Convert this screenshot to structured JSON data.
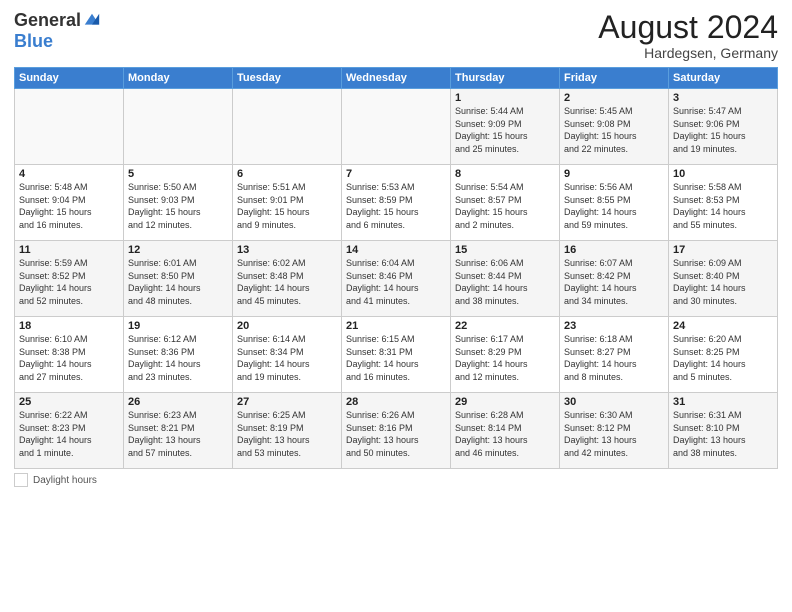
{
  "logo": {
    "general": "General",
    "blue": "Blue"
  },
  "title": {
    "month_year": "August 2024",
    "location": "Hardegsen, Germany"
  },
  "days_of_week": [
    "Sunday",
    "Monday",
    "Tuesday",
    "Wednesday",
    "Thursday",
    "Friday",
    "Saturday"
  ],
  "legend": {
    "label": "Daylight hours"
  },
  "weeks": [
    [
      {
        "day": "",
        "info": ""
      },
      {
        "day": "",
        "info": ""
      },
      {
        "day": "",
        "info": ""
      },
      {
        "day": "",
        "info": ""
      },
      {
        "day": "1",
        "info": "Sunrise: 5:44 AM\nSunset: 9:09 PM\nDaylight: 15 hours\nand 25 minutes."
      },
      {
        "day": "2",
        "info": "Sunrise: 5:45 AM\nSunset: 9:08 PM\nDaylight: 15 hours\nand 22 minutes."
      },
      {
        "day": "3",
        "info": "Sunrise: 5:47 AM\nSunset: 9:06 PM\nDaylight: 15 hours\nand 19 minutes."
      }
    ],
    [
      {
        "day": "4",
        "info": "Sunrise: 5:48 AM\nSunset: 9:04 PM\nDaylight: 15 hours\nand 16 minutes."
      },
      {
        "day": "5",
        "info": "Sunrise: 5:50 AM\nSunset: 9:03 PM\nDaylight: 15 hours\nand 12 minutes."
      },
      {
        "day": "6",
        "info": "Sunrise: 5:51 AM\nSunset: 9:01 PM\nDaylight: 15 hours\nand 9 minutes."
      },
      {
        "day": "7",
        "info": "Sunrise: 5:53 AM\nSunset: 8:59 PM\nDaylight: 15 hours\nand 6 minutes."
      },
      {
        "day": "8",
        "info": "Sunrise: 5:54 AM\nSunset: 8:57 PM\nDaylight: 15 hours\nand 2 minutes."
      },
      {
        "day": "9",
        "info": "Sunrise: 5:56 AM\nSunset: 8:55 PM\nDaylight: 14 hours\nand 59 minutes."
      },
      {
        "day": "10",
        "info": "Sunrise: 5:58 AM\nSunset: 8:53 PM\nDaylight: 14 hours\nand 55 minutes."
      }
    ],
    [
      {
        "day": "11",
        "info": "Sunrise: 5:59 AM\nSunset: 8:52 PM\nDaylight: 14 hours\nand 52 minutes."
      },
      {
        "day": "12",
        "info": "Sunrise: 6:01 AM\nSunset: 8:50 PM\nDaylight: 14 hours\nand 48 minutes."
      },
      {
        "day": "13",
        "info": "Sunrise: 6:02 AM\nSunset: 8:48 PM\nDaylight: 14 hours\nand 45 minutes."
      },
      {
        "day": "14",
        "info": "Sunrise: 6:04 AM\nSunset: 8:46 PM\nDaylight: 14 hours\nand 41 minutes."
      },
      {
        "day": "15",
        "info": "Sunrise: 6:06 AM\nSunset: 8:44 PM\nDaylight: 14 hours\nand 38 minutes."
      },
      {
        "day": "16",
        "info": "Sunrise: 6:07 AM\nSunset: 8:42 PM\nDaylight: 14 hours\nand 34 minutes."
      },
      {
        "day": "17",
        "info": "Sunrise: 6:09 AM\nSunset: 8:40 PM\nDaylight: 14 hours\nand 30 minutes."
      }
    ],
    [
      {
        "day": "18",
        "info": "Sunrise: 6:10 AM\nSunset: 8:38 PM\nDaylight: 14 hours\nand 27 minutes."
      },
      {
        "day": "19",
        "info": "Sunrise: 6:12 AM\nSunset: 8:36 PM\nDaylight: 14 hours\nand 23 minutes."
      },
      {
        "day": "20",
        "info": "Sunrise: 6:14 AM\nSunset: 8:34 PM\nDaylight: 14 hours\nand 19 minutes."
      },
      {
        "day": "21",
        "info": "Sunrise: 6:15 AM\nSunset: 8:31 PM\nDaylight: 14 hours\nand 16 minutes."
      },
      {
        "day": "22",
        "info": "Sunrise: 6:17 AM\nSunset: 8:29 PM\nDaylight: 14 hours\nand 12 minutes."
      },
      {
        "day": "23",
        "info": "Sunrise: 6:18 AM\nSunset: 8:27 PM\nDaylight: 14 hours\nand 8 minutes."
      },
      {
        "day": "24",
        "info": "Sunrise: 6:20 AM\nSunset: 8:25 PM\nDaylight: 14 hours\nand 5 minutes."
      }
    ],
    [
      {
        "day": "25",
        "info": "Sunrise: 6:22 AM\nSunset: 8:23 PM\nDaylight: 14 hours\nand 1 minute."
      },
      {
        "day": "26",
        "info": "Sunrise: 6:23 AM\nSunset: 8:21 PM\nDaylight: 13 hours\nand 57 minutes."
      },
      {
        "day": "27",
        "info": "Sunrise: 6:25 AM\nSunset: 8:19 PM\nDaylight: 13 hours\nand 53 minutes."
      },
      {
        "day": "28",
        "info": "Sunrise: 6:26 AM\nSunset: 8:16 PM\nDaylight: 13 hours\nand 50 minutes."
      },
      {
        "day": "29",
        "info": "Sunrise: 6:28 AM\nSunset: 8:14 PM\nDaylight: 13 hours\nand 46 minutes."
      },
      {
        "day": "30",
        "info": "Sunrise: 6:30 AM\nSunset: 8:12 PM\nDaylight: 13 hours\nand 42 minutes."
      },
      {
        "day": "31",
        "info": "Sunrise: 6:31 AM\nSunset: 8:10 PM\nDaylight: 13 hours\nand 38 minutes."
      }
    ]
  ]
}
